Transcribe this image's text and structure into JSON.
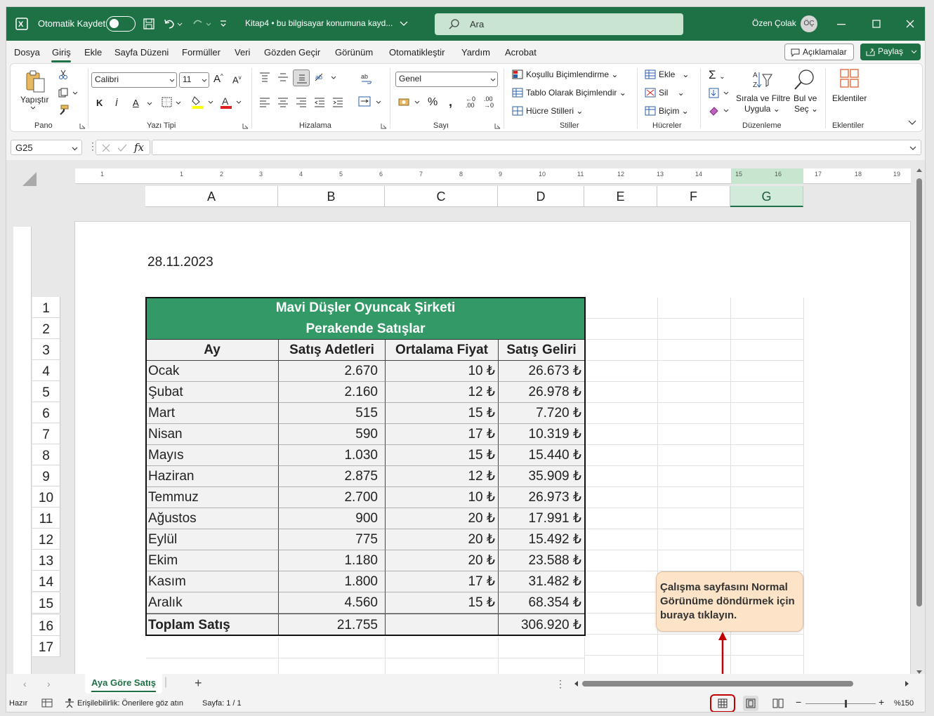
{
  "titlebar": {
    "autosave_label": "Otomatik Kaydet",
    "doc_title": "Kitap4 • bu bilgisayar konumuna kayd...",
    "search_placeholder": "Ara",
    "user_name": "Özen Çolak",
    "user_initials": "ÖÇ"
  },
  "menu": {
    "items": [
      "Dosya",
      "Giriş",
      "Ekle",
      "Sayfa Düzeni",
      "Formüller",
      "Veri",
      "Gözden Geçir",
      "Görünüm",
      "Otomatikleştir",
      "Yardım",
      "Acrobat"
    ],
    "comments_label": "Açıklamalar",
    "share_label": "Paylaş"
  },
  "ribbon": {
    "paste_label": "Yapıştır",
    "group_clipboard": "Pano",
    "font_name": "Calibri",
    "font_size": "11",
    "bold": "K",
    "italic": "İ",
    "underline": "A",
    "group_font": "Yazı Tipi",
    "group_alignment": "Hizalama",
    "number_format": "Genel",
    "group_number": "Sayı",
    "conditional_formatting": "Koşullu Biçimlendirme",
    "format_as_table": "Tablo Olarak Biçimlendir",
    "cell_styles": "Hücre Stilleri",
    "group_styles": "Stiller",
    "insert": "Ekle",
    "delete": "Sil",
    "format": "Biçim",
    "group_cells": "Hücreler",
    "sort_filter_1": "Sırala ve Filtre",
    "sort_filter_2": "Uygula",
    "find_select_1": "Bul ve",
    "find_select_2": "Seç",
    "group_editing": "Düzenleme",
    "addins": "Eklentiler",
    "group_addins": "Eklentiler",
    "colors": {
      "accent": "#1e7145",
      "font_red": "#e01f1f",
      "highlight_yellow": "#ffff00"
    }
  },
  "formula_bar": {
    "name_box": "G25",
    "fx": "fx",
    "formula": ""
  },
  "ruler": {
    "ticks": [
      "1",
      "1",
      "2",
      "3",
      "4",
      "5",
      "6",
      "7",
      "8",
      "9",
      "10",
      "11",
      "12",
      "13",
      "14",
      "15",
      "16",
      "17",
      "18",
      "19"
    ]
  },
  "columns": [
    "A",
    "B",
    "C",
    "D",
    "E",
    "F",
    "G"
  ],
  "rows": [
    "1",
    "2",
    "3",
    "4",
    "5",
    "6",
    "7",
    "8",
    "9",
    "10",
    "11",
    "12",
    "13",
    "14",
    "15",
    "16",
    "17"
  ],
  "sheet": {
    "date": "28.11.2023",
    "title1": "Mavi Düşler Oyuncak Şirketi",
    "title2": "Perakende Satışlar",
    "header_color": "#339966",
    "headers": [
      "Ay",
      "Satış Adetleri",
      "Ortalama Fiyat",
      "Satış Geliri"
    ],
    "data": [
      [
        "Ocak",
        "2.670",
        "10 ₺",
        "26.673 ₺"
      ],
      [
        "Şubat",
        "2.160",
        "12 ₺",
        "26.978 ₺"
      ],
      [
        "Mart",
        "515",
        "15 ₺",
        "7.720 ₺"
      ],
      [
        "Nisan",
        "590",
        "17 ₺",
        "10.319 ₺"
      ],
      [
        "Mayıs",
        "1.030",
        "15 ₺",
        "15.440 ₺"
      ],
      [
        "Haziran",
        "2.875",
        "12 ₺",
        "35.909 ₺"
      ],
      [
        "Temmuz",
        "2.700",
        "10 ₺",
        "26.973 ₺"
      ],
      [
        "Ağustos",
        "900",
        "20 ₺",
        "17.991 ₺"
      ],
      [
        "Eylül",
        "775",
        "20 ₺",
        "15.492 ₺"
      ],
      [
        "Ekim",
        "1.180",
        "20 ₺",
        "23.588 ₺"
      ],
      [
        "Kasım",
        "1.800",
        "17 ₺",
        "31.482 ₺"
      ],
      [
        "Aralık",
        "4.560",
        "15 ₺",
        "68.354 ₺"
      ]
    ],
    "total": [
      "Toplam Satış",
      "21.755",
      "",
      "306.920 ₺"
    ]
  },
  "tabs": {
    "sheet_name": "Aya Göre Satış"
  },
  "status": {
    "ready": "Hazır",
    "accessibility": "Erişilebilirlik: Önerilere göz atın",
    "page": "Sayfa: 1 / 1",
    "zoom": "%150"
  },
  "callout": {
    "text": "Çalışma sayfasını Normal Görünüme döndürmek için buraya tıklayın.",
    "highlight_color": "#c00000"
  }
}
